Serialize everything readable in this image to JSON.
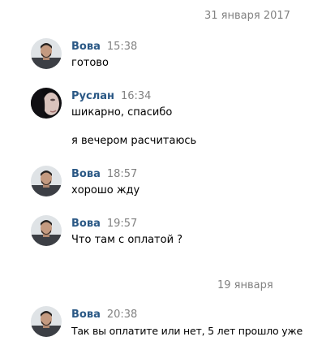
{
  "date_separators": [
    "31 января 2017",
    "19 января"
  ],
  "colors": {
    "author": "#2a5885",
    "time": "#828282",
    "text": "#000000",
    "background": "#ffffff"
  },
  "messages": [
    {
      "author": "Вова",
      "time": "15:38",
      "avatar_icon": "man-avatar-icon",
      "lines": [
        "готово"
      ]
    },
    {
      "author": "Руслан",
      "time": "16:34",
      "avatar_icon": "woman-face-avatar-icon",
      "lines": [
        "шикарно, спасибо",
        "я вечером расчитаюсь"
      ]
    },
    {
      "author": "Вова",
      "time": "18:57",
      "avatar_icon": "man-avatar-icon",
      "lines": [
        "хорошо жду"
      ]
    },
    {
      "author": "Вова",
      "time": "19:57",
      "avatar_icon": "man-avatar-icon",
      "lines": [
        "Что там с оплатой ?"
      ]
    },
    {
      "author": "Вова",
      "time": "20:38",
      "avatar_icon": "man-avatar-icon",
      "lines": [
        "Так вы оплатите или нет, 5 лет прошло уже"
      ]
    }
  ]
}
